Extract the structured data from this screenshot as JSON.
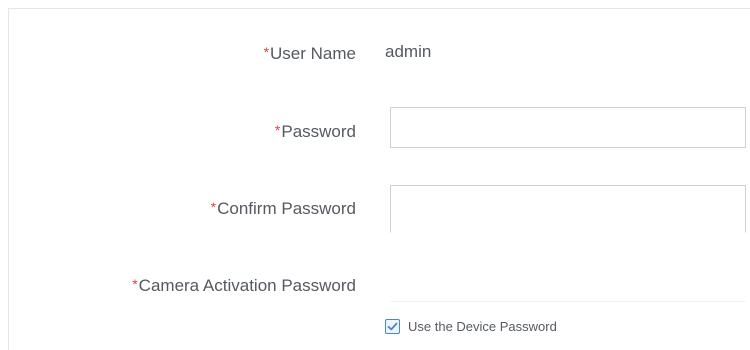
{
  "form": {
    "required_mark": "*",
    "user_name": {
      "label": "User Name",
      "value": "admin"
    },
    "password": {
      "label": "Password",
      "value": ""
    },
    "confirm_password": {
      "label": "Confirm Password",
      "value": ""
    },
    "camera_activation_password": {
      "label": "Camera Activation Password",
      "value": ""
    },
    "use_device_password": {
      "label": "Use the Device Password",
      "checked": true
    }
  },
  "colors": {
    "required": "#d9443f",
    "text": "#555a60",
    "border": "#cdd1d6",
    "checkbox_accent": "#4a86c8"
  },
  "icons": {
    "checkbox": "checkmark-icon"
  }
}
